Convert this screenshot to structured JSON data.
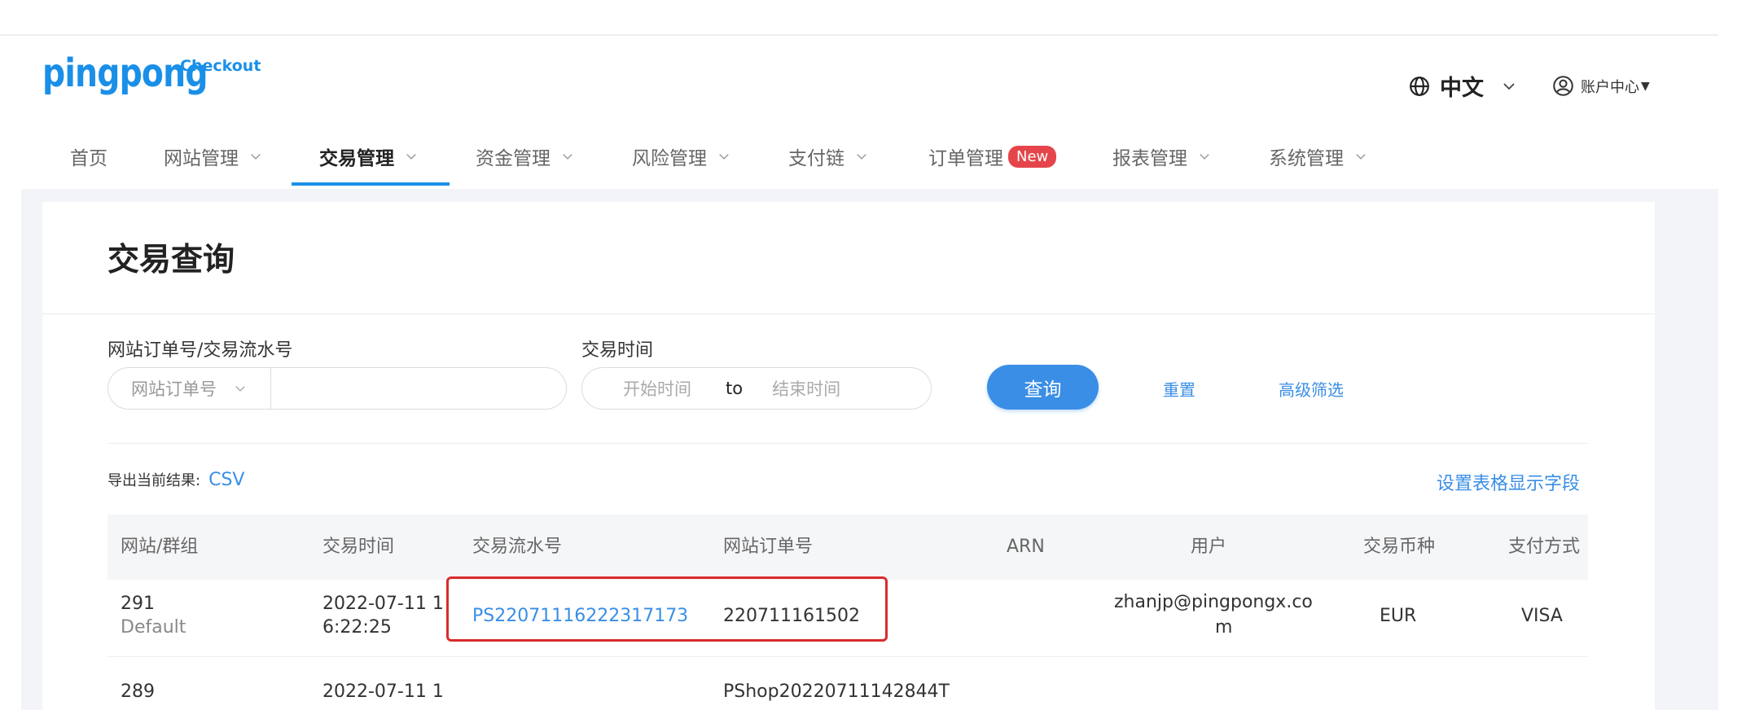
{
  "header": {
    "logo_main": "pingpong",
    "logo_sub": "Checkout",
    "language": "中文",
    "account": "账户中心"
  },
  "nav": {
    "items": [
      {
        "label": "首页"
      },
      {
        "label": "网站管理"
      },
      {
        "label": "交易管理"
      },
      {
        "label": "资金管理"
      },
      {
        "label": "风险管理"
      },
      {
        "label": "支付链"
      },
      {
        "label": "订单管理",
        "badge": "New"
      },
      {
        "label": "报表管理"
      },
      {
        "label": "系统管理"
      }
    ],
    "active": "交易管理"
  },
  "page": {
    "title": "交易查询"
  },
  "filters": {
    "order_label": "网站订单号/交易流水号",
    "order_select": "网站订单号",
    "order_value": "",
    "time_label": "交易时间",
    "start_placeholder": "开始时间",
    "to": "to",
    "end_placeholder": "结束时间",
    "query_button": "查询",
    "reset": "重置",
    "advanced": "高级筛选"
  },
  "toolbar": {
    "export_label": "导出当前结果:",
    "csv": "CSV",
    "set_columns": "设置表格显示字段"
  },
  "table": {
    "columns": [
      "网站/群组",
      "交易时间",
      "交易流水号",
      "网站订单号",
      "ARN",
      "用户",
      "交易币种",
      "支付方式"
    ],
    "rows": [
      {
        "site": "291",
        "group": "Default",
        "time_1": "2022-07-11 1",
        "time_2": "6:22:25",
        "serial": "PS22071116222317173",
        "order": "220711161502",
        "arn": "",
        "user_1": "zhanjp@pingpongx.co",
        "user_2": "m",
        "currency": "EUR",
        "method": "VISA"
      },
      {
        "site": "289",
        "time_1": "2022-07-11 1",
        "order": "PShop20220711142844T"
      }
    ]
  },
  "colors": {
    "brand": "#1a8fe8",
    "link": "#3a8ee6",
    "badge": "#e5454a",
    "highlight": "#d92b2b"
  }
}
